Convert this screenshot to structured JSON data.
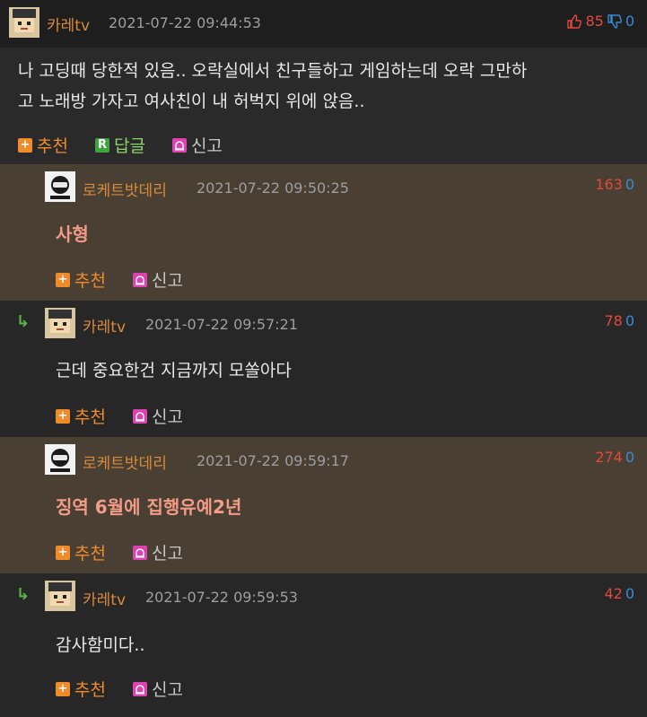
{
  "comments": [
    {
      "user": "카레tv",
      "time": "2021-07-22 09:44:53",
      "up": "85",
      "down": "0",
      "text_line1": "나 고딩때 당한적 있음.. 오락실에서 친구들하고 게임하는데 오락 그만하",
      "text_line2": "고 노래방 가자고 여사친이 내 허벅지 위에 앉음..",
      "actions": {
        "recommend": "추천",
        "reply": "답글",
        "report": "신고"
      }
    },
    {
      "user": "로케트밧데리",
      "time": "2021-07-22 09:50:25",
      "up": "163",
      "down": "0",
      "text": "사형",
      "actions": {
        "recommend": "추천",
        "report": "신고"
      }
    },
    {
      "user": "카레tv",
      "time": "2021-07-22 09:57:21",
      "up": "78",
      "down": "0",
      "text": "근데 중요한건 지금까지 모쏠아다",
      "actions": {
        "recommend": "추천",
        "report": "신고"
      }
    },
    {
      "user": "로케트밧데리",
      "time": "2021-07-22 09:59:17",
      "up": "274",
      "down": "0",
      "text": "징역 6월에 집행유예2년",
      "actions": {
        "recommend": "추천",
        "report": "신고"
      }
    },
    {
      "user": "카레tv",
      "time": "2021-07-22 09:59:53",
      "up": "42",
      "down": "0",
      "text": "감사함미다..",
      "actions": {
        "recommend": "추천",
        "report": "신고"
      }
    }
  ],
  "icons": {
    "recommend": "plus-icon",
    "reply": "reply-r-icon",
    "report": "siren-icon",
    "thread": "reply-arrow-icon",
    "thumbs_up": "thumbs-up-icon",
    "thumbs_down": "thumbs-down-icon"
  },
  "colors": {
    "username": "#d98b3a",
    "highlight_text": "#f29b86",
    "upvote": "#e0493e",
    "downvote": "#3b8ad8"
  }
}
